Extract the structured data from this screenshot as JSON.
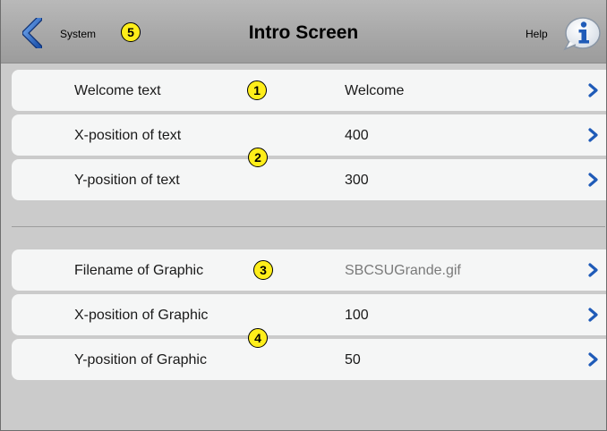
{
  "header": {
    "back_label": "System",
    "title": "Intro Screen",
    "help_label": "Help",
    "back_icon": "chevron-left-icon",
    "help_icon": "info-icon"
  },
  "callouts": [
    "1",
    "2",
    "3",
    "4",
    "5"
  ],
  "groups": [
    {
      "rows": [
        {
          "label": "Welcome text",
          "value": "Welcome"
        },
        {
          "label": "X-position of text",
          "value": "400"
        },
        {
          "label": "Y-position of text",
          "value": "300"
        }
      ]
    },
    {
      "rows": [
        {
          "label": "Filename of Graphic",
          "value": "SBCSUGrande.gif"
        },
        {
          "label": "X-position of Graphic",
          "value": "100"
        },
        {
          "label": "Y-position of Graphic",
          "value": "50"
        }
      ]
    }
  ],
  "colors": {
    "accent_blue": "#1f5bb8",
    "callout_yellow": "#ffee1a"
  }
}
